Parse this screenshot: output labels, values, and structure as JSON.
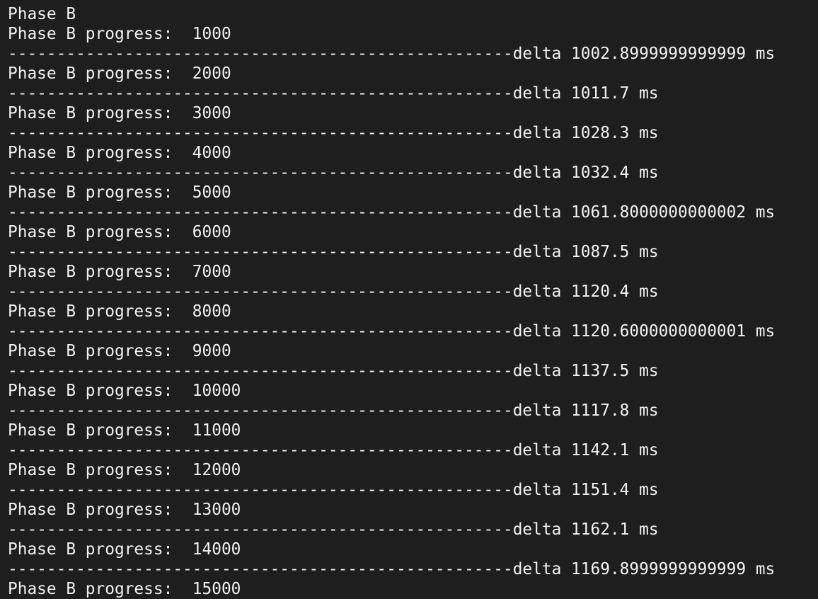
{
  "terminal": {
    "lines": [
      "Phase B",
      "Phase B progress:  1000",
      "----------------------------------------------------delta 1002.8999999999999 ms",
      "Phase B progress:  2000",
      "----------------------------------------------------delta 1011.7 ms",
      "Phase B progress:  3000",
      "----------------------------------------------------delta 1028.3 ms",
      "Phase B progress:  4000",
      "----------------------------------------------------delta 1032.4 ms",
      "Phase B progress:  5000",
      "----------------------------------------------------delta 1061.8000000000002 ms",
      "Phase B progress:  6000",
      "----------------------------------------------------delta 1087.5 ms",
      "Phase B progress:  7000",
      "----------------------------------------------------delta 1120.4 ms",
      "Phase B progress:  8000",
      "----------------------------------------------------delta 1120.6000000000001 ms",
      "Phase B progress:  9000",
      "----------------------------------------------------delta 1137.5 ms",
      "Phase B progress:  10000",
      "----------------------------------------------------delta 1117.8 ms",
      "Phase B progress:  11000",
      "----------------------------------------------------delta 1142.1 ms",
      "Phase B progress:  12000",
      "----------------------------------------------------delta 1151.4 ms",
      "Phase B progress:  13000",
      "----------------------------------------------------delta 1162.1 ms",
      "Phase B progress:  14000",
      "----------------------------------------------------delta 1169.8999999999999 ms",
      "Phase B progress:  15000"
    ]
  },
  "colors": {
    "background": "#1e1e1e",
    "text": "#f2f2f2"
  }
}
